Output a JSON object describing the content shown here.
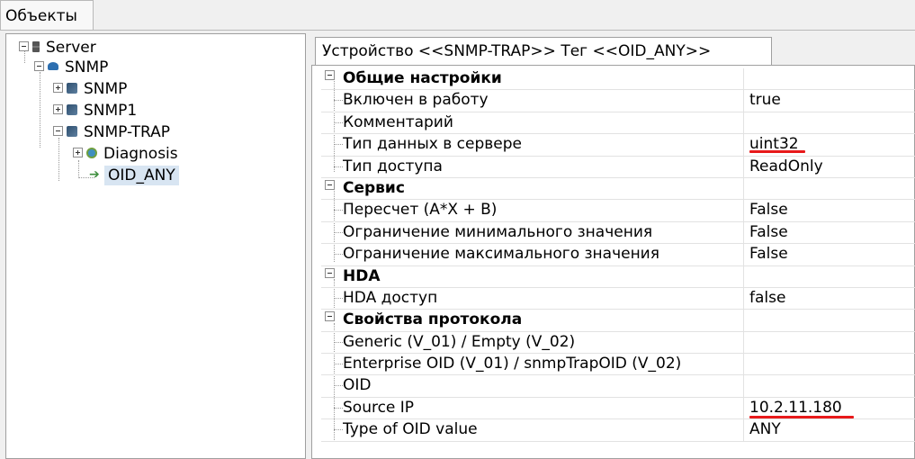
{
  "window": {
    "panel_tab": "Объекты"
  },
  "tree": {
    "nodes": [
      {
        "label": "Server",
        "icon": "server-icon"
      },
      {
        "label": "SNMP",
        "icon": "network-icon"
      },
      {
        "label": "SNMP",
        "icon": "device-icon"
      },
      {
        "label": "SNMP1",
        "icon": "device-icon"
      },
      {
        "label": "SNMP-TRAP",
        "icon": "device-icon"
      },
      {
        "label": "Diagnosis",
        "icon": "diagnosis-icon"
      },
      {
        "label": "OID_ANY",
        "icon": "tag-arrow-icon"
      }
    ]
  },
  "properties": {
    "tab_title": "Устройство <<SNMP-TRAP>> Тег  <<OID_ANY>>",
    "rows": [
      {
        "name": "Общие настройки",
        "value": ""
      },
      {
        "name": "Включен в работу",
        "value": "true"
      },
      {
        "name": "Комментарий",
        "value": ""
      },
      {
        "name": "Тип данных в сервере",
        "value": "uint32"
      },
      {
        "name": "Тип доступа",
        "value": "ReadOnly"
      },
      {
        "name": "Сервис",
        "value": ""
      },
      {
        "name": "Пересчет (A*X + B)",
        "value": "False"
      },
      {
        "name": "Ограничение минимального значения",
        "value": "False"
      },
      {
        "name": "Ограничение максимального значения",
        "value": "False"
      },
      {
        "name": "HDA",
        "value": ""
      },
      {
        "name": "HDA доступ",
        "value": "false"
      },
      {
        "name": "Свойства протокола",
        "value": ""
      },
      {
        "name": "Generic (V_01) / Empty (V_02)",
        "value": ""
      },
      {
        "name": "Enterprise OID (V_01) / snmpTrapOID (V_02)",
        "value": ""
      },
      {
        "name": "OID",
        "value": ""
      },
      {
        "name": "Source IP",
        "value": "10.2.11.180"
      },
      {
        "name": "Type of OID value",
        "value": "ANY"
      }
    ]
  },
  "colors": {
    "selection": "#d8e5f2",
    "highlight_underline": "#e8191a"
  }
}
